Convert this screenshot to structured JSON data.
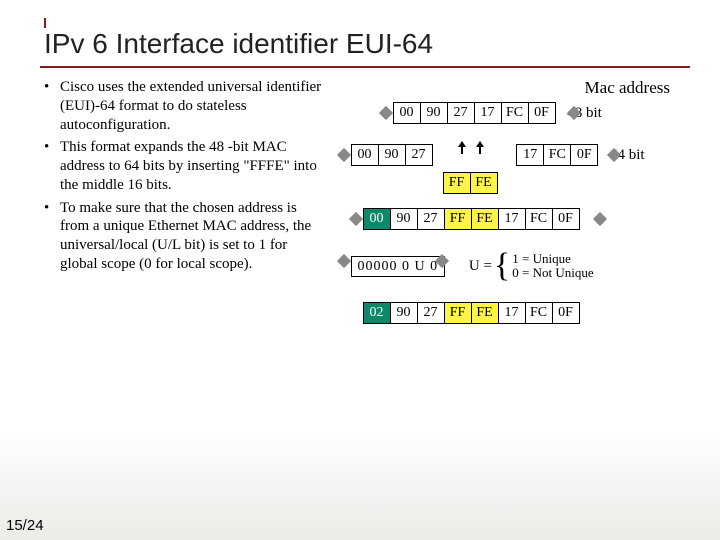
{
  "title": "IPv 6 Interface identifier EUI-64",
  "bullets": [
    "Cisco uses the extended universal identifier (EUI)-64 format to do stateless autoconfiguration.",
    "This format expands the 48 -bit MAC address to 64 bits by inserting \"FFFE\" into the middle 16 bits.",
    "To make sure that the chosen address is from a unique Ethernet MAC address, the universal/local (U/L bit) is set to 1 for global scope (0 for local scope)."
  ],
  "mac_label": "Mac address",
  "note48": "48 bit",
  "note64": "64 bit",
  "row1": [
    "00",
    "90",
    "27",
    "17",
    "FC",
    "0F"
  ],
  "row2_left": [
    "00",
    "90",
    "27"
  ],
  "row2_right": [
    "17",
    "FC",
    "0F"
  ],
  "inserted": [
    "FF",
    "FE"
  ],
  "row3": [
    "00",
    "90",
    "27",
    "FF",
    "FE",
    "17",
    "FC",
    "0F"
  ],
  "binary": "00000 0 U 0",
  "ueq": "U =",
  "u1": "1 = Unique",
  "u0": "0 = Not Unique",
  "row4": [
    "02",
    "90",
    "27",
    "FF",
    "FE",
    "17",
    "FC",
    "0F"
  ],
  "pagenum": "15/24"
}
